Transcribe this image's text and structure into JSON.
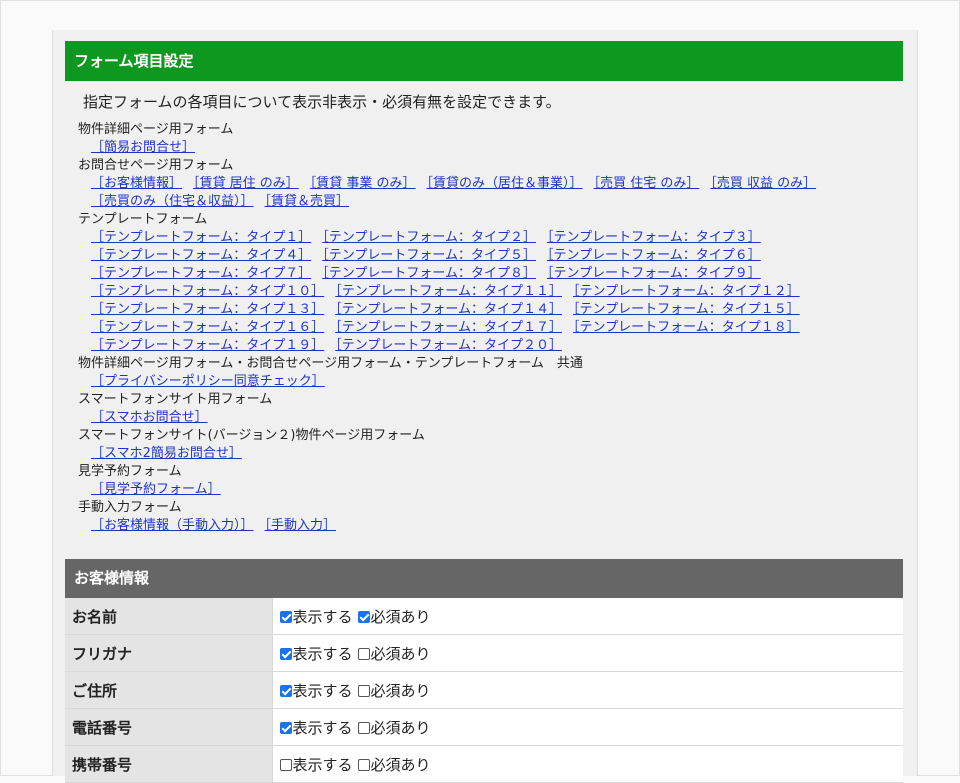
{
  "section1": {
    "title": "フォーム項目設定",
    "intro": "指定フォームの各項目について表示非表示・必須有無を設定できます。"
  },
  "form_tree": [
    {
      "category": "物件詳細ページ用フォーム",
      "links": [
        [
          "［簡易お問合せ］"
        ]
      ]
    },
    {
      "category": "お問合せページ用フォーム",
      "links": [
        [
          "［お客様情報］",
          "［賃貸 居住 のみ］",
          "［賃貸 事業 のみ］",
          "［賃貸のみ（居住＆事業）］",
          "［売買 住宅 のみ］",
          "［売買 収益 のみ］"
        ],
        [
          "［売買のみ（住宅＆収益）］",
          "［賃貸＆売買］"
        ]
      ]
    },
    {
      "category": "テンプレートフォーム",
      "links": [
        [
          "［テンプレートフォーム：タイプ１］",
          "［テンプレートフォーム：タイプ２］",
          "［テンプレートフォーム：タイプ３］"
        ],
        [
          "［テンプレートフォーム：タイプ４］",
          "［テンプレートフォーム：タイプ５］",
          "［テンプレートフォーム：タイプ６］"
        ],
        [
          "［テンプレートフォーム：タイプ７］",
          "［テンプレートフォーム：タイプ８］",
          "［テンプレートフォーム：タイプ９］"
        ],
        [
          "［テンプレートフォーム：タイプ１０］",
          "［テンプレートフォーム：タイプ１１］",
          "［テンプレートフォーム：タイプ１２］"
        ],
        [
          "［テンプレートフォーム：タイプ１３］",
          "［テンプレートフォーム：タイプ１４］",
          "［テンプレートフォーム：タイプ１５］"
        ],
        [
          "［テンプレートフォーム：タイプ１６］",
          "［テンプレートフォーム：タイプ１７］",
          "［テンプレートフォーム：タイプ１８］"
        ],
        [
          "［テンプレートフォーム：タイプ１９］",
          "［テンプレートフォーム：タイプ２０］"
        ]
      ]
    },
    {
      "category": "物件詳細ページ用フォーム・お問合せページ用フォーム・テンプレートフォーム　共通",
      "links": [
        [
          "［プライバシーポリシー同意チェック］"
        ]
      ]
    },
    {
      "category": "スマートフォンサイト用フォーム",
      "links": [
        [
          "［スマホお問合せ］"
        ]
      ]
    },
    {
      "category": "スマートフォンサイト(バージョン２)物件ページ用フォーム",
      "links": [
        [
          "［スマホ2簡易お問合せ］"
        ]
      ]
    },
    {
      "category": "見学予約フォーム",
      "links": [
        [
          "［見学予約フォーム］"
        ]
      ]
    },
    {
      "category": "手動入力フォーム",
      "links": [
        [
          "［お客様情報（手動入力）］",
          "［手動入力］"
        ]
      ]
    }
  ],
  "section2": {
    "title": "お客様情報",
    "show_label": "表示する",
    "required_label": "必須あり"
  },
  "fields": [
    {
      "label": "お名前",
      "show": true,
      "required": true
    },
    {
      "label": "フリガナ",
      "show": true,
      "required": false
    },
    {
      "label": "ご住所",
      "show": true,
      "required": false
    },
    {
      "label": "電話番号",
      "show": true,
      "required": false
    },
    {
      "label": "携帯番号",
      "show": false,
      "required": false
    }
  ]
}
